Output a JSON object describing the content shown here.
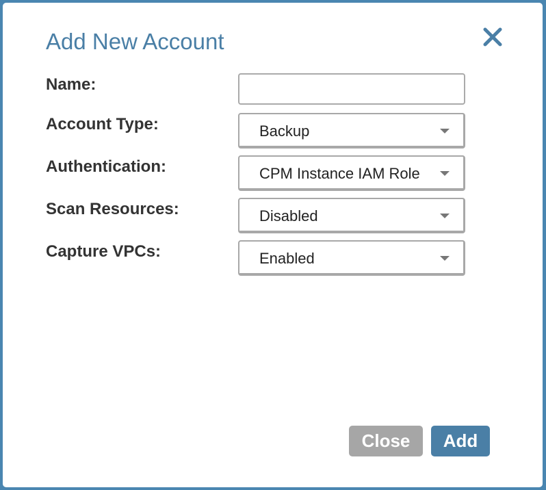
{
  "dialog": {
    "title": "Add New Account",
    "close_icon": "close-icon"
  },
  "form": {
    "name": {
      "label": "Name:",
      "value": "",
      "placeholder": ""
    },
    "account_type": {
      "label": "Account Type:",
      "selected": "Backup"
    },
    "authentication": {
      "label": "Authentication:",
      "selected": "CPM Instance IAM Role"
    },
    "scan_resources": {
      "label": "Scan Resources:",
      "selected": "Disabled"
    },
    "capture_vpcs": {
      "label": "Capture VPCs:",
      "selected": "Enabled"
    }
  },
  "buttons": {
    "close_label": "Close",
    "add_label": "Add"
  },
  "colors": {
    "accent": "#4a7fa6",
    "border_frame": "#4a86b1",
    "close_button": "#a6a6a6"
  }
}
